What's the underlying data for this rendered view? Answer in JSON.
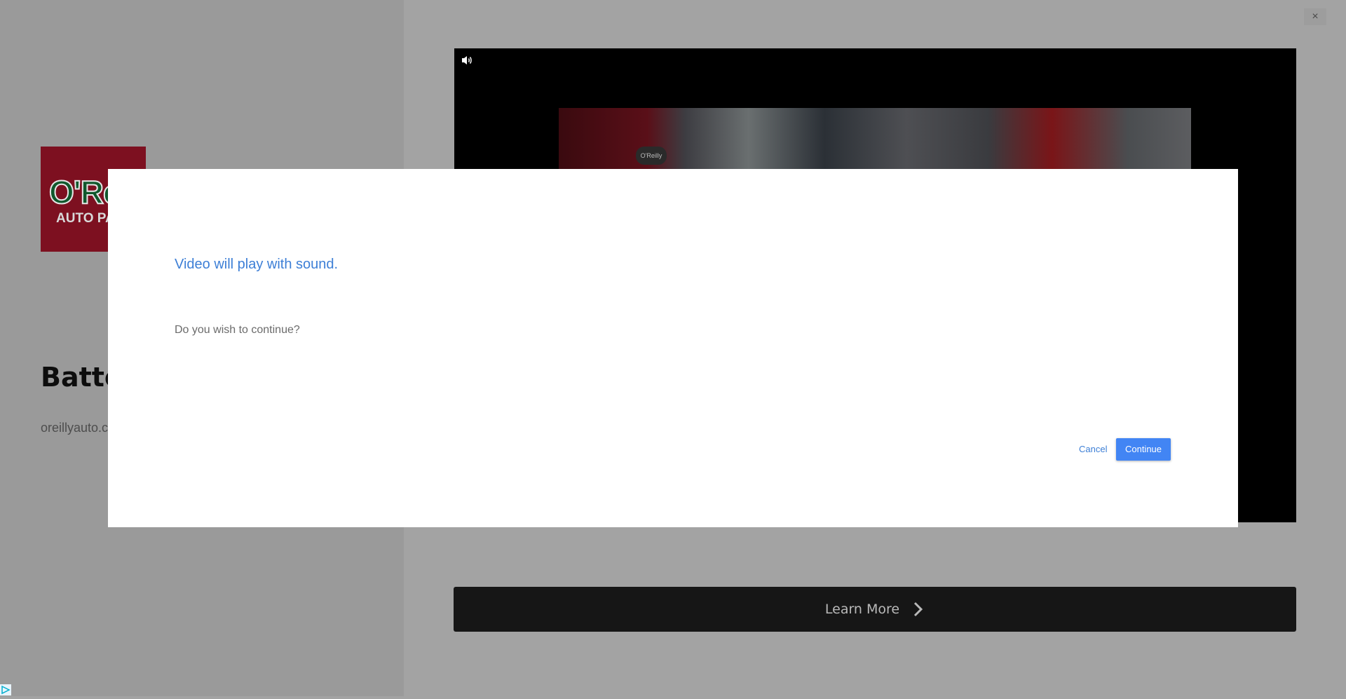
{
  "ad": {
    "logo": {
      "line1": "O'Rei",
      "line2": "AUTO PA"
    },
    "title": "Batte",
    "domain": "oreillyauto.c",
    "learn_more_label": "Learn More",
    "close_icon": "×"
  },
  "video": {
    "sound_icon": "speaker-icon",
    "badge_text": "O'Reilly"
  },
  "modal": {
    "title": "Video will play with sound.",
    "message": "Do you wish to continue?",
    "cancel_label": "Cancel",
    "continue_label": "Continue"
  },
  "colors": {
    "accent": "#4285f4",
    "link": "#3d7fd6",
    "logo_bg": "#7d1020"
  }
}
